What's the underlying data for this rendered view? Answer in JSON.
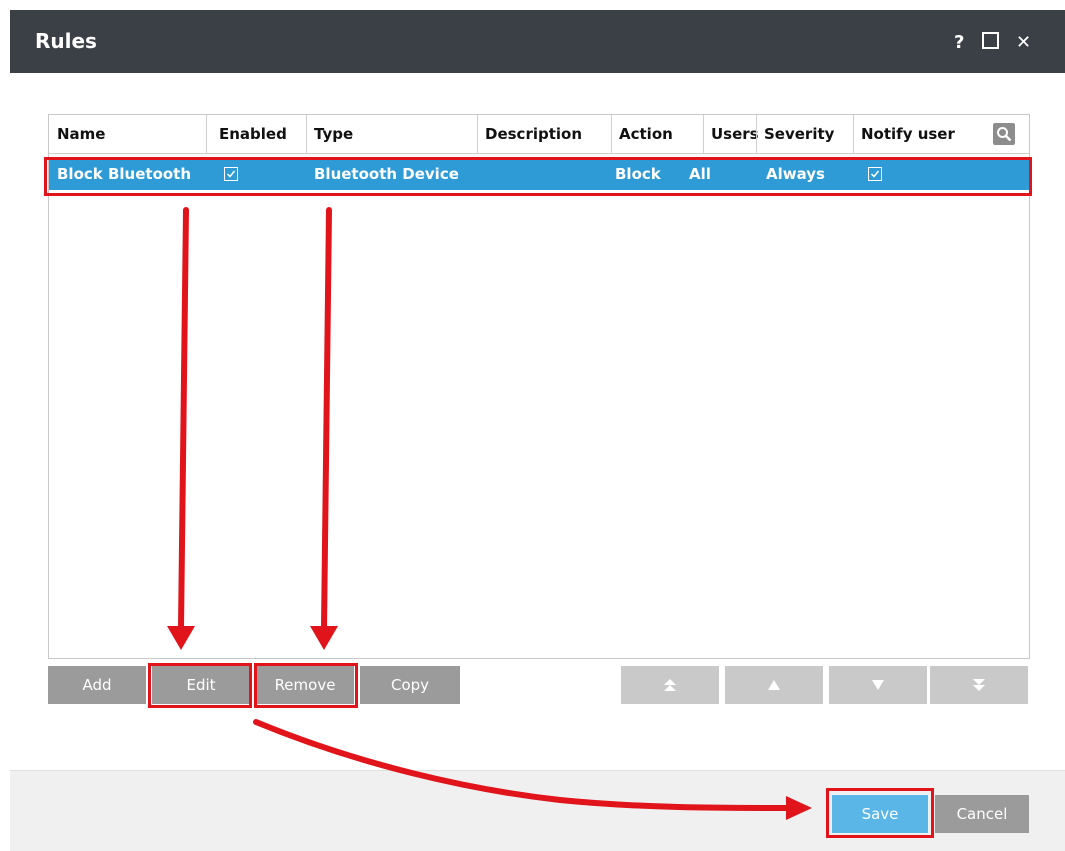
{
  "window": {
    "title": "Rules",
    "help_label": "?",
    "close_label": "✕"
  },
  "table": {
    "columns": [
      "Name",
      "Enabled",
      "Type",
      "Description",
      "Action",
      "Users",
      "Severity",
      "Notify user"
    ],
    "rows": [
      {
        "name": "Block Bluetooth",
        "enabled": true,
        "type": "Bluetooth Device",
        "description": "",
        "action": "Block",
        "users": "All",
        "severity": "Always",
        "notify_user": true
      }
    ]
  },
  "buttons": {
    "add": "Add",
    "edit": "Edit",
    "remove": "Remove",
    "copy": "Copy",
    "save": "Save",
    "cancel": "Cancel"
  },
  "move_buttons": [
    "move-top",
    "move-up",
    "move-down",
    "move-bottom"
  ],
  "colors": {
    "titlebar": "#3b3f46",
    "selection": "#2e9bd6",
    "highlight": "#e0141a",
    "save": "#59b6e7"
  },
  "icons": {
    "search": "search-icon",
    "help": "help-icon",
    "maximize": "maximize-icon",
    "close": "close-icon"
  }
}
